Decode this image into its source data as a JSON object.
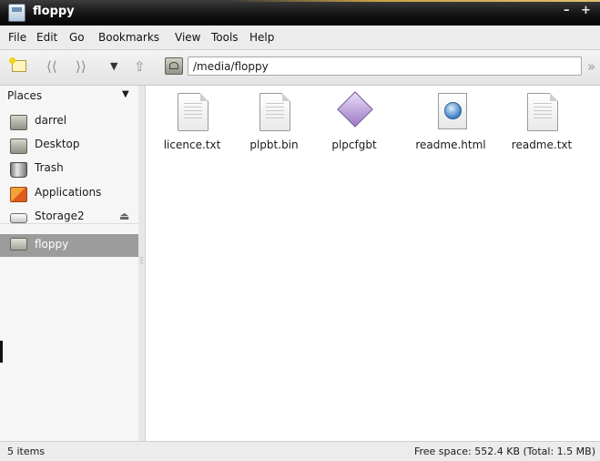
{
  "window": {
    "title": "floppy",
    "minimize": "–",
    "maximize": "+"
  },
  "menu": [
    "File",
    "Edit",
    "Go",
    "Bookmarks",
    "View",
    "Tools",
    "Help"
  ],
  "toolbar": {
    "location": "/media/floppy",
    "icons": [
      "new-tab-icon",
      "back-icon",
      "forward-icon",
      "history-dropdown-icon",
      "up-icon",
      "location-toggle-icon"
    ]
  },
  "sidebar": {
    "header": "Places",
    "items": [
      {
        "label": "darrel",
        "icon": "home-folder-icon"
      },
      {
        "label": "Desktop",
        "icon": "desktop-folder-icon"
      },
      {
        "label": "Trash",
        "icon": "trash-icon"
      },
      {
        "label": "Applications",
        "icon": "applications-icon"
      },
      {
        "label": "Storage2",
        "icon": "drive-icon"
      }
    ],
    "selected": {
      "label": "floppy",
      "icon": "floppy-folder-icon"
    }
  },
  "files": [
    {
      "name": "licence.txt",
      "icon": "text-file-icon"
    },
    {
      "name": "plpbt.bin",
      "icon": "binary-file-icon"
    },
    {
      "name": "plpcfgbt",
      "icon": "executable-icon"
    },
    {
      "name": "readme.html",
      "icon": "html-file-icon"
    },
    {
      "name": "readme.txt",
      "icon": "text-file-icon"
    }
  ],
  "status": {
    "items": "5 items",
    "free_space": "Free space: 552.4 KB (Total: 1.5 MB)"
  }
}
